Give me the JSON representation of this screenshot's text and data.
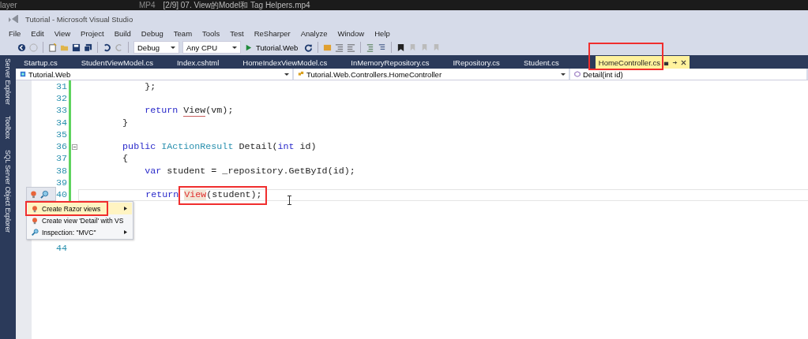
{
  "player_bar": {
    "app": "layer",
    "format": "MP4",
    "title": "[2/9] 07. View的Model和 Tag Helpers.mp4"
  },
  "window": {
    "title": "Tutorial - Microsoft Visual Studio"
  },
  "menu": [
    "File",
    "Edit",
    "View",
    "Project",
    "Build",
    "Debug",
    "Team",
    "Tools",
    "Test",
    "ReSharper",
    "Analyze",
    "Window",
    "Help"
  ],
  "toolbar": {
    "configuration": "Debug",
    "platform": "Any CPU",
    "start": "Tutorial.Web"
  },
  "side_panels": [
    "Server Explorer",
    "Toolbox",
    "SQL Server Object Explorer"
  ],
  "tabs": [
    {
      "label": "Startup.cs",
      "selected": false
    },
    {
      "label": "StudentViewModel.cs",
      "selected": false
    },
    {
      "label": "Index.cshtml",
      "selected": false
    },
    {
      "label": "HomeIndexViewModel.cs",
      "selected": false
    },
    {
      "label": "InMemoryRepository.cs",
      "selected": false
    },
    {
      "label": "IRepository.cs",
      "selected": false
    },
    {
      "label": "Student.cs",
      "selected": false
    },
    {
      "label": "HomeController.cs",
      "selected": true,
      "annotated": true
    }
  ],
  "nav_bar": [
    "Tutorial.Web",
    "Tutorial.Web.Controllers.HomeController",
    "Detail(int id)"
  ],
  "editor": {
    "lines": [
      {
        "number": "31",
        "tokens": [
          {
            "kind": "plain",
            "text": "            };"
          }
        ]
      },
      {
        "number": "32"
      },
      {
        "number": "33",
        "tokens": [
          {
            "kind": "keyword",
            "text": "            return "
          },
          {
            "kind": "squiggle",
            "text": "View"
          },
          {
            "kind": "plain",
            "text": "(vm);"
          }
        ]
      },
      {
        "number": "34",
        "tokens": [
          {
            "kind": "plain",
            "text": "        }"
          }
        ]
      },
      {
        "number": "35"
      },
      {
        "number": "36",
        "fold": true,
        "tokens": [
          {
            "kind": "keyword",
            "text": "        public "
          },
          {
            "kind": "type",
            "text": "IActionResult"
          },
          {
            "kind": "plain",
            "text": " Detail("
          },
          {
            "kind": "keyword",
            "text": "int"
          },
          {
            "kind": "plain",
            "text": " id)"
          }
        ]
      },
      {
        "number": "37",
        "tokens": [
          {
            "kind": "plain",
            "text": "        {"
          }
        ]
      },
      {
        "number": "38",
        "tokens": [
          {
            "kind": "keyword",
            "text": "            var"
          },
          {
            "kind": "plain",
            "text": " student = _repository.GetById(id);"
          }
        ]
      },
      {
        "number": "39"
      },
      {
        "number": "40",
        "current": true,
        "annotated": true,
        "tokens": [
          {
            "kind": "keyword",
            "text": "            return "
          },
          {
            "kind": "error",
            "text": "View"
          },
          {
            "kind": "plain",
            "text": "(student);"
          }
        ]
      }
    ],
    "trailing_line_number": "44"
  },
  "quick_fix_menu": [
    {
      "label": "Create Razor views",
      "kind": "action",
      "submenu": true,
      "selected": true,
      "annotated": true
    },
    {
      "label": "Create view 'Detail' with VS",
      "kind": "action",
      "submenu": false,
      "selected": false
    },
    {
      "label": "Inspection: \"MVC\"",
      "kind": "inspection",
      "submenu": true,
      "selected": false
    }
  ]
}
